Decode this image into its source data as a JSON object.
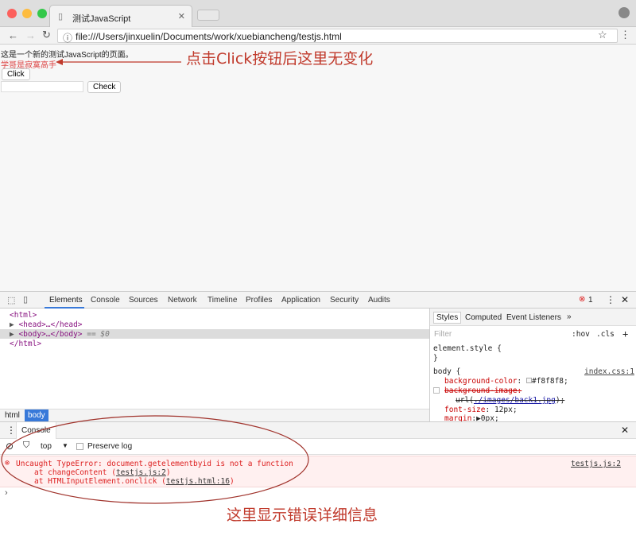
{
  "browser": {
    "tab_title": "测试JavaScript",
    "url": "file:///Users/jinxuelin/Documents/work/xuebiancheng/testjs.html"
  },
  "page": {
    "line1": "这是一个新的测试JavaScript的页面。",
    "line2": "学哥是寂寞高手",
    "click_button": "Click",
    "check_button": "Check",
    "input_value": ""
  },
  "annotations": {
    "top_note": "点击Click按钮后这里无变化",
    "bottom_note": "这里显示错误详细信息",
    "color": "#c0392b"
  },
  "devtools": {
    "tabs": [
      "Elements",
      "Console",
      "Sources",
      "Network",
      "Timeline",
      "Profiles",
      "Application",
      "Security",
      "Audits"
    ],
    "active_tab": "Elements",
    "error_count": "1",
    "dom": [
      "<html>",
      "<head>…</head>",
      "<body>…</body>",
      " == $0",
      "</html>"
    ],
    "breadcrumb": [
      "html",
      "body"
    ],
    "styles_tabs": [
      "Styles",
      "Computed",
      "Event Listeners",
      "»"
    ],
    "filter_placeholder": "Filter",
    "hov": ":hov",
    "cls": ".cls",
    "element_style": "element.style {",
    "close_brace": "}",
    "body_rule": "body {",
    "body_source": "index.css:1",
    "props": [
      {
        "name": "background-color",
        "value": "#f8f8f8;"
      },
      {
        "name": "background-image:",
        "value": ""
      },
      {
        "name": "url(",
        "value": "./images/back1.jpg"
      },
      {
        "name": "font-size",
        "value": "12px;"
      },
      {
        "name": "margin",
        "value": "▶0px;"
      }
    ]
  },
  "console": {
    "drawer_tab": "Console",
    "context": "top",
    "preserve_log": "Preserve log",
    "error_message": "Uncaught TypeError: document.getelementbyid is not a function",
    "stack1_prefix": "at changeContent (",
    "stack1_link": "testjs.js:2",
    "stack2_prefix": "at HTMLInputElement.onclick (",
    "stack2_link": "testjs.html:16",
    "source": "testjs.js:2",
    "prompt": "›"
  }
}
